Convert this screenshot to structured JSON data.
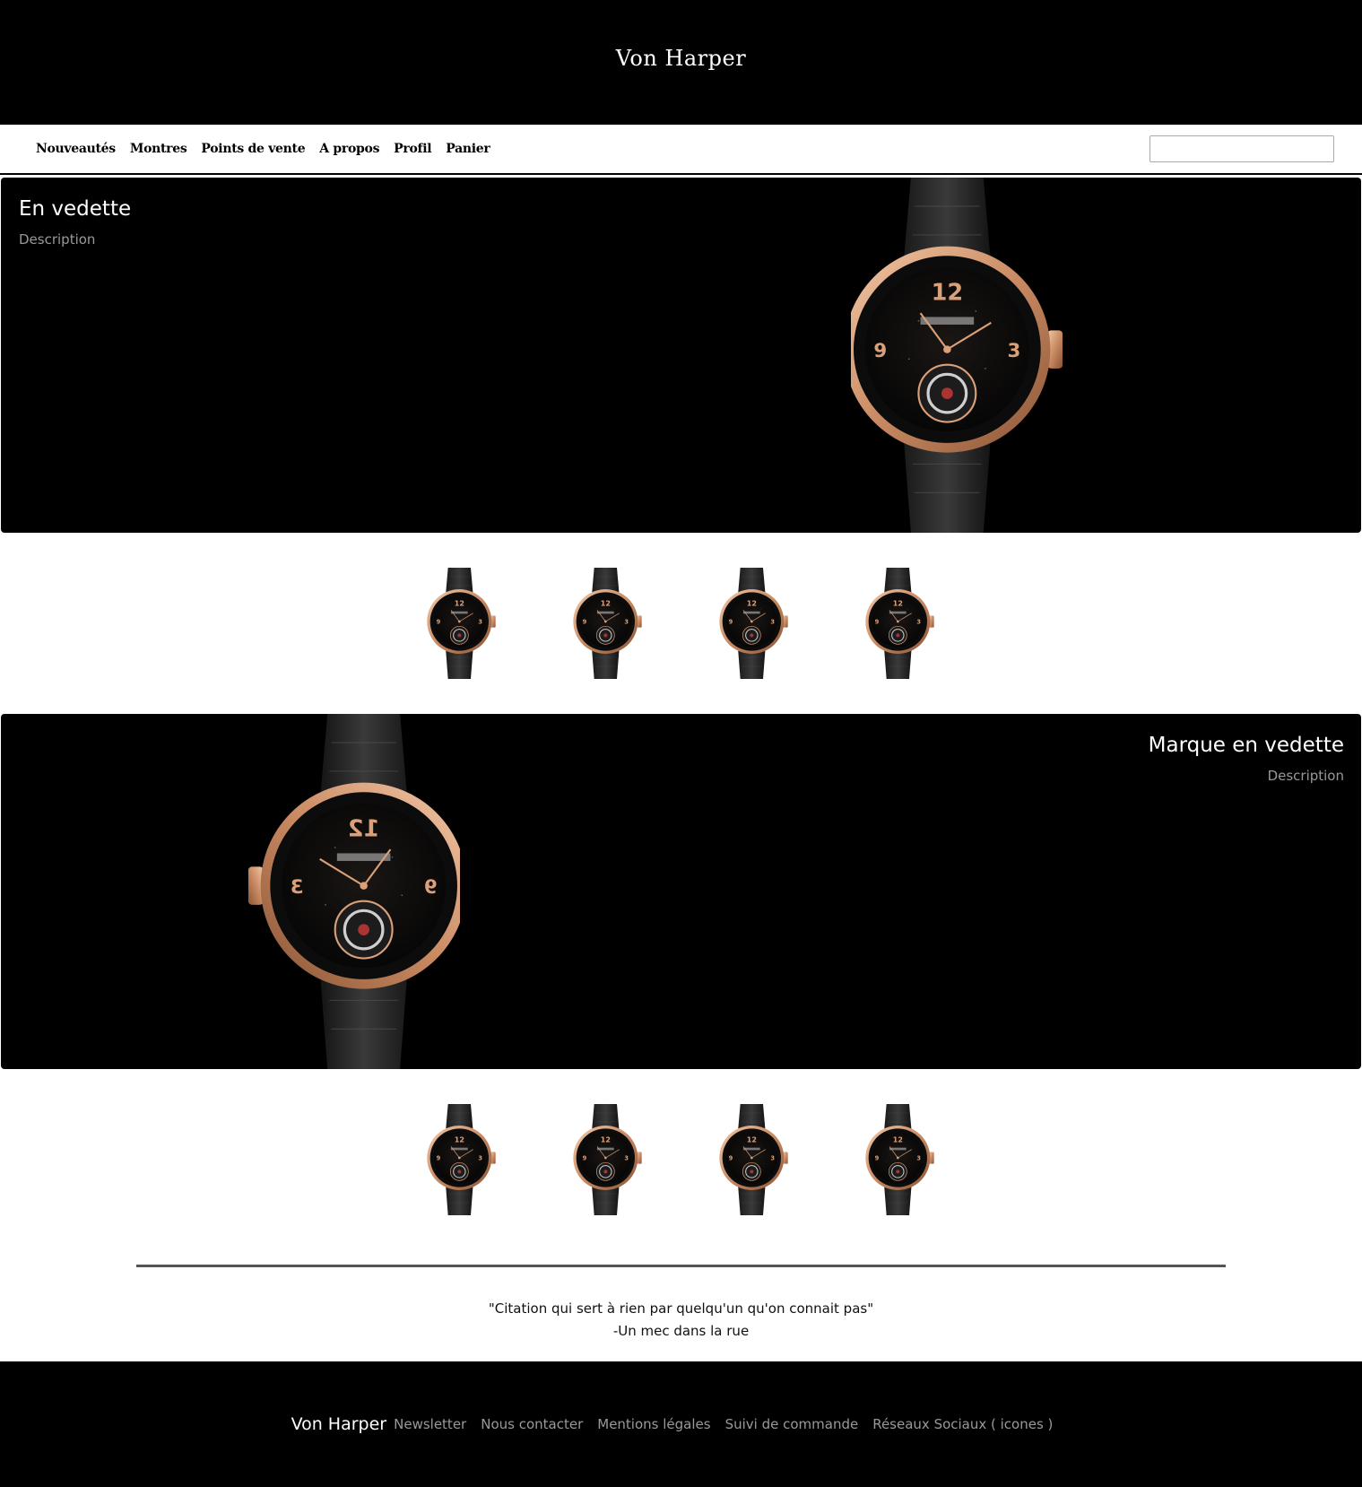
{
  "header": {
    "brand": "Von Harper"
  },
  "nav": {
    "items": [
      {
        "label": "Nouveautés"
      },
      {
        "label": "Montres"
      },
      {
        "label": "Points de vente"
      },
      {
        "label": "A propos"
      },
      {
        "label": "Profil"
      },
      {
        "label": "Panier"
      }
    ],
    "search_placeholder": ""
  },
  "featured": {
    "title": "En vedette",
    "description": "Description",
    "image": "watch-image"
  },
  "featured_thumbs": [
    "watch-thumbnail",
    "watch-thumbnail",
    "watch-thumbnail",
    "watch-thumbnail"
  ],
  "brand_featured": {
    "title": "Marque en vedette",
    "description": "Description",
    "image": "watch-image"
  },
  "brand_thumbs": [
    "watch-thumbnail",
    "watch-thumbnail",
    "watch-thumbnail",
    "watch-thumbnail"
  ],
  "quote": {
    "text": "\"Citation qui sert à rien par quelqu'un qu'on connait pas\"",
    "author": "-Un mec dans la rue"
  },
  "footer": {
    "brand": "Von Harper",
    "links": [
      {
        "label": "Newsletter"
      },
      {
        "label": "Nous contacter"
      },
      {
        "label": "Mentions légales"
      },
      {
        "label": "Suivi de commande"
      },
      {
        "label": "Réseaux Sociaux ( icones )"
      }
    ]
  },
  "colors": {
    "accent_gold": "#d9a07a",
    "background_dark": "#000000",
    "muted_text": "#999999"
  }
}
